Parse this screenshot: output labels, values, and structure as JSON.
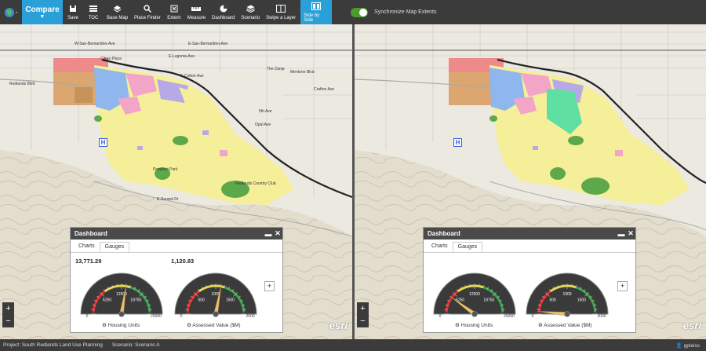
{
  "toolbar": {
    "compare_label": "Compare",
    "tools": [
      {
        "label": "Save",
        "icon": "save-icon"
      },
      {
        "label": "TOC",
        "icon": "list-icon"
      },
      {
        "label": "Base Map",
        "icon": "layers-icon"
      },
      {
        "label": "Place Finder",
        "icon": "search-icon"
      },
      {
        "label": "Extent",
        "icon": "extent-icon"
      },
      {
        "label": "Measure",
        "icon": "ruler-icon"
      },
      {
        "label": "Dashboard",
        "icon": "pie-chart-icon"
      },
      {
        "label": "Scenario",
        "icon": "stack-icon"
      },
      {
        "label": "Swipe a Layer",
        "icon": "swipe-icon"
      },
      {
        "label": "Side by Side",
        "icon": "side-by-side-icon"
      }
    ],
    "sync_label": "Synchronize Map Extents"
  },
  "map_labels": {
    "sb_ave_top": "W-San-Bernardino-Ave",
    "e_sb_ave": "E-San-Bernardino-Ave",
    "lugonia": "E-Lugonia-Ave",
    "mentone": "Mentone Blvd",
    "redlands": "Redlands Blvd",
    "colton": "E-Colton-Ave",
    "fifth": "5th Ave",
    "crafton": "Crafton Ave",
    "opal": "Opal Ave",
    "citrus": "Citrus Plaza",
    "zanja": "The Zanja",
    "country_club": "Redlands Country Club",
    "high_park": "Prospect Park",
    "sunset": "E-Sunset-Dr"
  },
  "dashboard": {
    "title": "Dashboard",
    "tabs": [
      "Charts",
      "Gauges"
    ],
    "left": {
      "housing_value": "13,771.29",
      "assessed_value": "1,120.83",
      "housing_label": "Housing Units",
      "assessed_label": "Assessed Value ($M)"
    },
    "right": {
      "housing_label": "Housing Units",
      "assessed_label": "Assessed Value ($M)"
    },
    "housing_ticks": [
      "0",
      "6250",
      "12500",
      "18750",
      "25000"
    ],
    "assessed_ticks": [
      "0",
      "500",
      "1000",
      "1500",
      "2000"
    ]
  },
  "gauges": {
    "left_housing_fraction": 0.55,
    "left_assessed_fraction": 0.56,
    "right_housing_fraction": 0.2,
    "right_assessed_fraction": 0.03
  },
  "status": {
    "project": "Project: South Redlands Land Use Planning",
    "scenario": "Scenario: Scenario A",
    "user": "gpleiss"
  },
  "attribution": "esri",
  "colors": {
    "accent": "#2aa0d8",
    "toolbar": "#3b3b3b",
    "residential": "#f5ef9a",
    "commercial": "#ef8a8a",
    "industrial": "#d99a5c"
  }
}
